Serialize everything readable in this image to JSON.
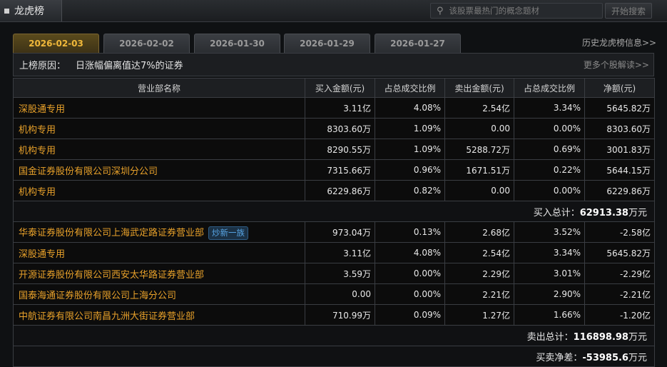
{
  "header": {
    "title": "龙虎榜",
    "search_placeholder": "该股票最热门的概念题材",
    "search_button": "开始搜索"
  },
  "tabs": [
    {
      "label": "2026-02-03",
      "active": true
    },
    {
      "label": "2026-02-02",
      "active": false
    },
    {
      "label": "2026-01-30",
      "active": false
    },
    {
      "label": "2026-01-29",
      "active": false
    },
    {
      "label": "2026-01-27",
      "active": false
    }
  ],
  "history_link": "历史龙虎榜信息>>",
  "reason": {
    "label": "上榜原因：",
    "text": "日涨幅偏离值达7%的证券",
    "more_link": "更多个股解读>>"
  },
  "columns": [
    "营业部名称",
    "买入金额(元)",
    "占总成交比例",
    "卖出金额(元)",
    "占总成交比例",
    "净额(元)"
  ],
  "buy_rows": [
    {
      "name": "深股通专用",
      "buy": "3.11亿",
      "buy_pct": "4.08%",
      "sell": "2.54亿",
      "sell_pct": "3.34%",
      "net": "5645.82万"
    },
    {
      "name": "机构专用",
      "buy": "8303.60万",
      "buy_pct": "1.09%",
      "sell": "0.00",
      "sell_pct": "0.00%",
      "net": "8303.60万"
    },
    {
      "name": "机构专用",
      "buy": "8290.55万",
      "buy_pct": "1.09%",
      "sell": "5288.72万",
      "sell_pct": "0.69%",
      "net": "3001.83万"
    },
    {
      "name": "国金证券股份有限公司深圳分公司",
      "buy": "7315.66万",
      "buy_pct": "0.96%",
      "sell": "1671.51万",
      "sell_pct": "0.22%",
      "net": "5644.15万"
    },
    {
      "name": "机构专用",
      "buy": "6229.86万",
      "buy_pct": "0.82%",
      "sell": "0.00",
      "sell_pct": "0.00%",
      "net": "6229.86万"
    }
  ],
  "buy_total": {
    "label": "买入总计：",
    "value": "62913.38",
    "unit": "万元"
  },
  "sell_rows": [
    {
      "name": "华泰证券股份有限公司上海武定路证券营业部",
      "badge": "炒新一族",
      "buy": "973.04万",
      "buy_pct": "0.13%",
      "sell": "2.68亿",
      "sell_pct": "3.52%",
      "net": "-2.58亿"
    },
    {
      "name": "深股通专用",
      "buy": "3.11亿",
      "buy_pct": "4.08%",
      "sell": "2.54亿",
      "sell_pct": "3.34%",
      "net": "5645.82万"
    },
    {
      "name": "开源证券股份有限公司西安太华路证券营业部",
      "buy": "3.59万",
      "buy_pct": "0.00%",
      "sell": "2.29亿",
      "sell_pct": "3.01%",
      "net": "-2.29亿"
    },
    {
      "name": "国泰海通证券股份有限公司上海分公司",
      "buy": "0.00",
      "buy_pct": "0.00%",
      "sell": "2.21亿",
      "sell_pct": "2.90%",
      "net": "-2.21亿"
    },
    {
      "name": "中航证券有限公司南昌九洲大街证券营业部",
      "buy": "710.99万",
      "buy_pct": "0.09%",
      "sell": "1.27亿",
      "sell_pct": "1.66%",
      "net": "-1.20亿"
    }
  ],
  "sell_total": {
    "label": "卖出总计：",
    "value": "116898.98",
    "unit": "万元"
  },
  "net_total": {
    "label": "买卖净差：",
    "value": "-53985.6",
    "unit": "万元"
  }
}
